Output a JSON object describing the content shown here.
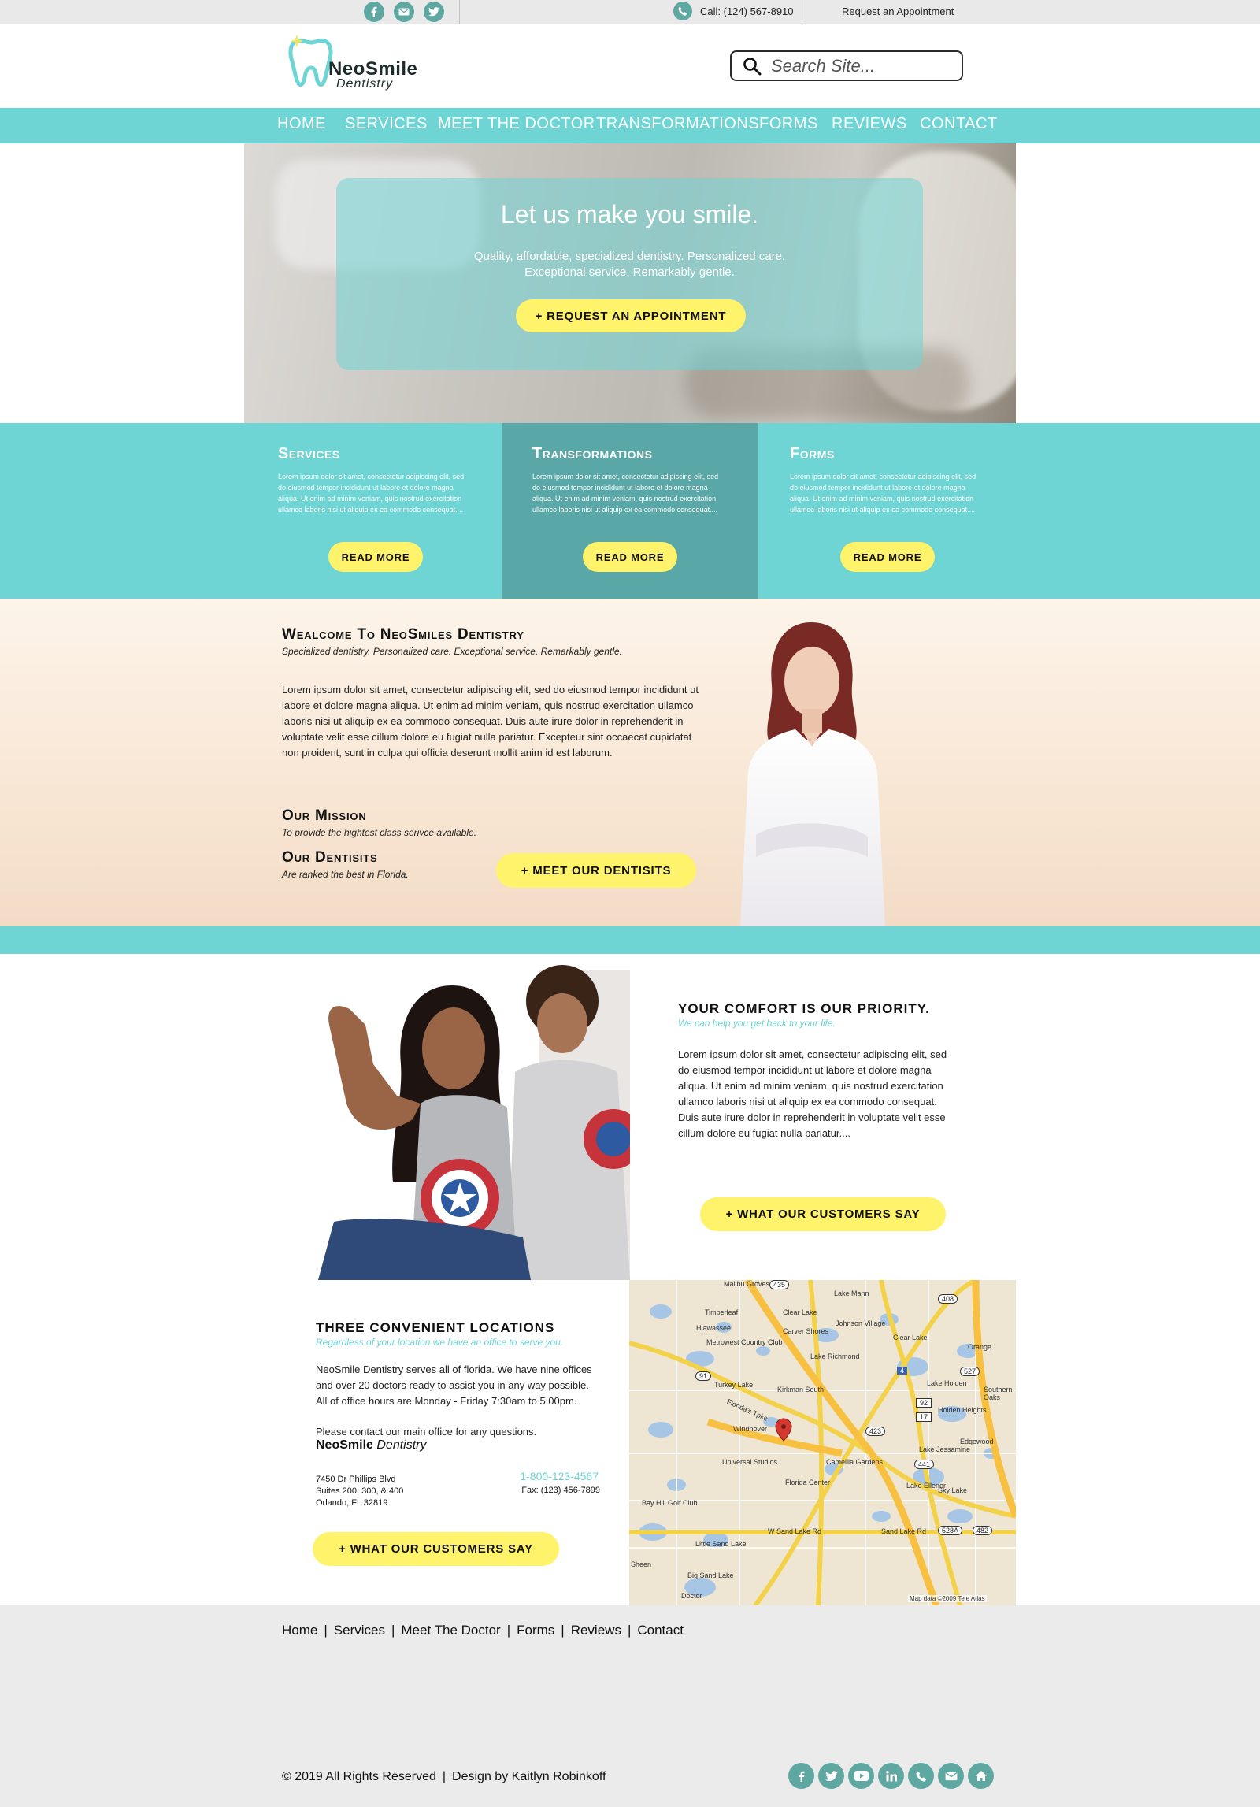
{
  "topbar": {
    "social_icons": [
      "facebook-icon",
      "email-icon",
      "twitter-icon"
    ],
    "phone": "Call: (124) 567-8910",
    "appointment_link": "Request an Appointment"
  },
  "logo": {
    "name": "NeoSmile",
    "sub": "Dentistry"
  },
  "search": {
    "placeholder": "Search Site..."
  },
  "nav": [
    "HOME",
    "SERVICES",
    "MEET THE DOCTOR",
    "TRANSFORMATIONS",
    "FORMS",
    "REVIEWS",
    "CONTACT"
  ],
  "hero": {
    "title": "Let us make you smile.",
    "subtitle_line1": "Quality, affordable, specialized dentistry. Personalized care.",
    "subtitle_line2": "Exceptional service. Remarkably gentle.",
    "button": "+ REQUEST AN APPOINTMENT"
  },
  "columns": [
    {
      "title": "Services",
      "text": "Lorem ipsum dolor sit amet, consectetur adipiscing elit, sed do eiusmod tempor incididunt ut labore et dolore magna aliqua. Ut enim ad minim veniam, quis nostrud exercitation ullamco laboris nisi ut aliquip ex ea commodo consequat....",
      "button": "READ MORE"
    },
    {
      "title": "Transformations",
      "text": "Lorem ipsum dolor sit amet, consectetur adipiscing elit, sed do eiusmod tempor incididunt ut labore et dolore magna aliqua. Ut enim ad minim veniam, quis nostrud exercitation ullamco laboris nisi ut aliquip ex ea commodo consequat....",
      "button": "READ MORE"
    },
    {
      "title": "Forms",
      "text": "Lorem ipsum dolor sit amet, consectetur adipiscing elit, sed do eiusmod tempor incididunt ut labore et dolore magna aliqua. Ut enim ad minim veniam, quis nostrud exercitation ullamco laboris nisi ut aliquip ex ea commodo consequat....",
      "button": "READ MORE"
    }
  ],
  "welcome": {
    "title": "Wealcome To NeoSmiles Dentistry",
    "subtitle": "Specialized dentistry. Personalized care. Exceptional service. Remarkably gentle.",
    "body": "Lorem ipsum dolor sit amet, consectetur adipiscing elit, sed do eiusmod tempor incididunt ut labore et dolore magna aliqua. Ut enim ad minim veniam, quis nostrud exercitation ullamco laboris nisi ut aliquip ex ea commodo consequat. Duis aute irure dolor in reprehenderit in voluptate velit esse cillum dolore eu fugiat nulla pariatur. Excepteur sint occaecat cupidatat non proident, sunt in culpa qui officia deserunt mollit anim id est laborum.",
    "mission_title": "Our Mission",
    "mission_sub": "To provide the hightest class serivce available.",
    "dentists_title": "Our Dentisits",
    "dentists_sub": "Are ranked the best in Florida.",
    "button": "+ MEET OUR DENTISITS"
  },
  "comfort": {
    "title": "YOUR COMFORT IS OUR PRIORITY.",
    "subtitle": "We can help you get back to your life.",
    "body": "Lorem ipsum dolor sit amet, consectetur adipiscing elit, sed do eiusmod tempor incididunt ut labore et dolore magna aliqua. Ut enim ad minim veniam, quis nostrud exercitation ullamco laboris nisi ut aliquip ex ea commodo consequat. Duis aute irure dolor in reprehenderit in voluptate velit esse cillum dolore eu fugiat nulla pariatur....",
    "button": "+ WHAT OUR CUSTOMERS SAY"
  },
  "locations": {
    "title": "THREE CONVENIENT LOCATIONS",
    "subtitle": "Regardless of your location we have an office to serve you.",
    "body": "NeoSmile Dentistry serves all of florida. We have nine offices and over 20 doctors ready to assist you in any way possible. All of office hours are Monday - Friday 7:30am to 5:00pm.",
    "contact_line": "Please contact our main office for any questions.",
    "brand_name": "NeoSmile",
    "brand_sub": "Dentistry",
    "address_line1": "7450 Dr Phillips Blvd",
    "address_line2": "Suites 200, 300, & 400",
    "address_line3": "Orlando, FL 32819",
    "phone": "1-800-123-4567",
    "fax": "Fax: (123) 456-7899",
    "button": "+ WHAT OUR CUSTOMERS SAY"
  },
  "map": {
    "labels": [
      "Malibu Groves",
      "Lake Mann",
      "Timberleaf",
      "Clear Lake",
      "Hiawassee",
      "Johnson Village",
      "Carver Shores",
      "Metrowest Country Club",
      "Clear Lake",
      "Orange",
      "Lake Richmond",
      "Turkey Lake",
      "Kirkman South",
      "Lake Holden",
      "Holden Heights",
      "Southern Oaks",
      "Windhover",
      "Edgewood",
      "Lake Jessamine",
      "Camellia Gardens",
      "Universal Studios",
      "Florida Center",
      "Lake Ellenor",
      "Sky Lake",
      "Bay Hill Golf Club",
      "Little Sand Lake",
      "Sheen",
      "Big Sand Lake",
      "Doctor",
      "Sand Lake Rd",
      "W Sand Lake Rd",
      "Florida's Tpke"
    ],
    "shields": [
      "435",
      "408",
      "91",
      "527",
      "4",
      "423",
      "17",
      "92",
      "441",
      "528A",
      "482"
    ],
    "credit": "Map data ©2009 Tele Atlas"
  },
  "footer": {
    "links": [
      "Home",
      "Services",
      "Meet The Doctor",
      "Forms",
      "Reviews",
      "Contact"
    ],
    "copyright": "© 2019 All Rights Reserved",
    "design": "Design by Kaitlyn Robinkoff",
    "social_icons": [
      "facebook-icon",
      "twitter-icon",
      "youtube-icon",
      "linkedin-icon",
      "phone-icon",
      "email-icon",
      "home-icon"
    ]
  },
  "colors": {
    "teal": "#6fd4d4",
    "dark_teal": "#5aa7a7",
    "yellow": "#fef36a",
    "icon": "#5fa8a2"
  }
}
